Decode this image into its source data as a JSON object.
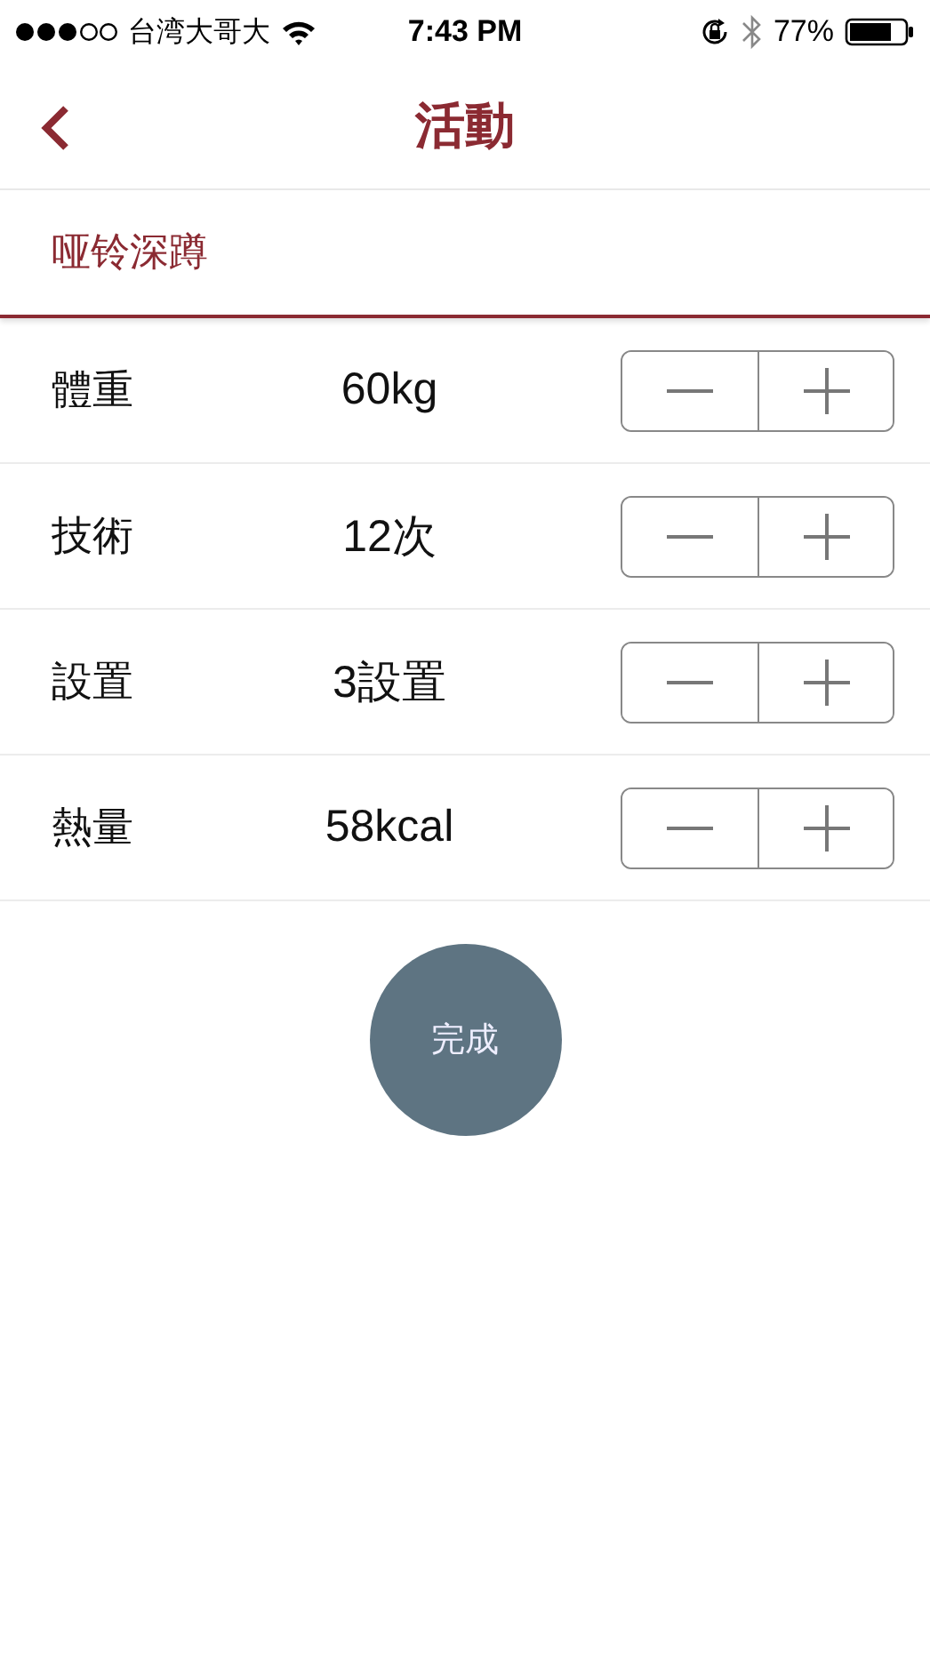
{
  "status_bar": {
    "carrier": "台湾大哥大",
    "time": "7:43 PM",
    "battery": "77%"
  },
  "nav": {
    "title": "活動"
  },
  "exercise": "哑铃深蹲",
  "rows": [
    {
      "label": "體重",
      "value": "60kg"
    },
    {
      "label": "技術",
      "value": "12次"
    },
    {
      "label": "設置",
      "value": "3設置"
    },
    {
      "label": "熱量",
      "value": "58kcal"
    }
  ],
  "done_button": "完成"
}
